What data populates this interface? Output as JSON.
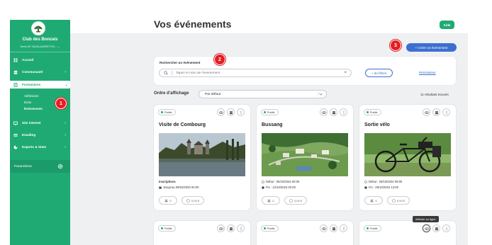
{
  "page": {
    "title": "Vos événements",
    "help_label": "Aide"
  },
  "sidebar": {
    "club_name": "Club des Bonzais",
    "club_subtitle": "Denis DE VAUDLAUDRE FSS...",
    "items": [
      {
        "label": "Accueil",
        "icon": "home-icon"
      },
      {
        "label": "Communauté",
        "icon": "community-icon"
      },
      {
        "label": "Formulaires",
        "icon": "forms-icon"
      },
      {
        "label": "Site internet",
        "icon": "website-icon"
      },
      {
        "label": "Emailing",
        "icon": "emailing-icon"
      },
      {
        "label": "Exports & Stats",
        "icon": "stats-icon"
      }
    ],
    "sub_items": [
      "Adhésions",
      "Dons",
      "Événements"
    ],
    "settings_label": "Paramètres"
  },
  "markers": {
    "one": "1",
    "two": "2",
    "three": "3"
  },
  "toolbar": {
    "create_label": "+ Créer un événement"
  },
  "search": {
    "label": "Rechercher un évènement",
    "placeholder": "Tapez le nom de l'évènement",
    "filters_label": "+ de filtres",
    "reset_label": "Réinitialiser"
  },
  "sort": {
    "label": "Ordre d'affichage",
    "value": "Par défaut",
    "results": "11 résultats trouvés"
  },
  "cards": [
    {
      "status": "Publié",
      "title": "Visite de Combourg",
      "info_title": "Inscriptions",
      "info_lines": [
        "Jusqu'au 09/04/2020 00:00"
      ],
      "count": "0",
      "amount": "0,00 €"
    },
    {
      "status": "Publié",
      "title": "Bussang",
      "info_lines": [
        "Début : 05/10/2024 00:00",
        "Fin : 12/10/2024 00:00"
      ],
      "count": "0",
      "amount": "0,00 €"
    },
    {
      "status": "Publié",
      "title": "Sortie vélo",
      "info_lines": [
        "Début : 29/10/2024 09:00",
        "Fin : 29/10/2024 13:00"
      ],
      "count": "0",
      "amount": "0,00 €"
    },
    {
      "status": "Publié"
    },
    {
      "status": "Publié"
    },
    {
      "status": "Publié"
    }
  ],
  "tooltip": "Afficher en ligne",
  "colors": {
    "brand": "#1faa74",
    "accent": "#3d6fd1",
    "marker": "#e31e24"
  }
}
